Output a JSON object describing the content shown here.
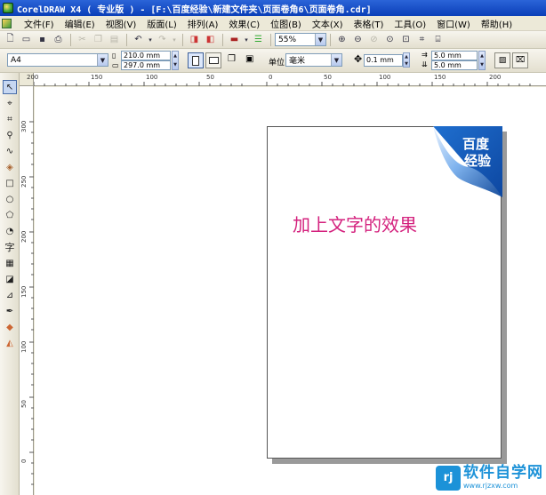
{
  "window": {
    "title": "CorelDRAW X4 ( 专业版 ) - [F:\\百度经验\\新建文件夹\\页面卷角6\\页面卷角.cdr]"
  },
  "menu": {
    "items": [
      {
        "label": "文件(F)"
      },
      {
        "label": "编辑(E)"
      },
      {
        "label": "视图(V)"
      },
      {
        "label": "版面(L)"
      },
      {
        "label": "排列(A)"
      },
      {
        "label": "效果(C)"
      },
      {
        "label": "位图(B)"
      },
      {
        "label": "文本(X)"
      },
      {
        "label": "表格(T)"
      },
      {
        "label": "工具(O)"
      },
      {
        "label": "窗口(W)"
      },
      {
        "label": "帮助(H)"
      }
    ]
  },
  "toolbar": {
    "zoom_value": "55%"
  },
  "property_bar": {
    "paper_type": "A4",
    "width": "210.0 mm",
    "height": "297.0 mm",
    "unit_label": "单位:",
    "unit_value": "毫米",
    "nudge": "0.1 mm",
    "dup_x": "5.0 mm",
    "dup_y": "5.0 mm"
  },
  "ruler": {
    "h_labels": [
      "200",
      "150",
      "100",
      "50",
      "0",
      "50",
      "100",
      "150",
      "200"
    ],
    "v_labels": [
      "300",
      "250",
      "200",
      "150",
      "100",
      "50",
      "0"
    ]
  },
  "document": {
    "page_text": "加上文字的效果",
    "corner_text_line1": "百度",
    "corner_text_line2": "经验",
    "text_color": "#d4227e",
    "corner_color": "#1a5fb4"
  },
  "watermark": {
    "logo": "rj",
    "name": "软件自学网",
    "url": "www.rjzxw.com"
  }
}
